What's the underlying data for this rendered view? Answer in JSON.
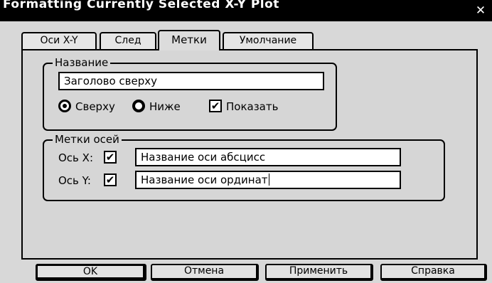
{
  "window": {
    "title": "Formatting Currently Selected X-Y Plot",
    "close_glyph": "✕"
  },
  "tabs": [
    {
      "label": "Оси X-Y",
      "selected": false
    },
    {
      "label": "След",
      "selected": false
    },
    {
      "label": "Метки",
      "selected": true
    },
    {
      "label": "Умолчание",
      "selected": false
    }
  ],
  "title_group": {
    "legend": "Название",
    "title_value": "Заголово сверху",
    "position_options": [
      {
        "label": "Сверху",
        "selected": true
      },
      {
        "label": "Ниже",
        "selected": false
      }
    ],
    "show_checkbox": {
      "label": "Показать",
      "checked": true
    }
  },
  "axis_group": {
    "legend": "Метки осей",
    "x_axis": {
      "label": "Ось X:",
      "checked": true,
      "value": "Название оси абсцисс"
    },
    "y_axis": {
      "label": "Ось Y:",
      "checked": true,
      "value": "Название оси ординат"
    }
  },
  "buttons": {
    "ok": "OK",
    "cancel": "Отмена",
    "apply": "Применить",
    "help": "Справка"
  },
  "glyphs": {
    "checkmark": "✔"
  }
}
